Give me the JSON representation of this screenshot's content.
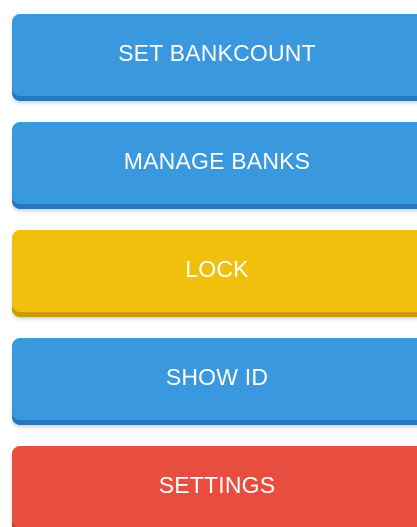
{
  "menu": {
    "buttons": [
      {
        "label": "SET BANKCOUNT",
        "color": "#3a98de"
      },
      {
        "label": "MANAGE BANKS",
        "color": "#3a98de"
      },
      {
        "label": "LOCK",
        "color": "#f0c00c"
      },
      {
        "label": "SHOW ID",
        "color": "#3a98de"
      },
      {
        "label": "SETTINGS",
        "color": "#e84e3f"
      }
    ]
  }
}
